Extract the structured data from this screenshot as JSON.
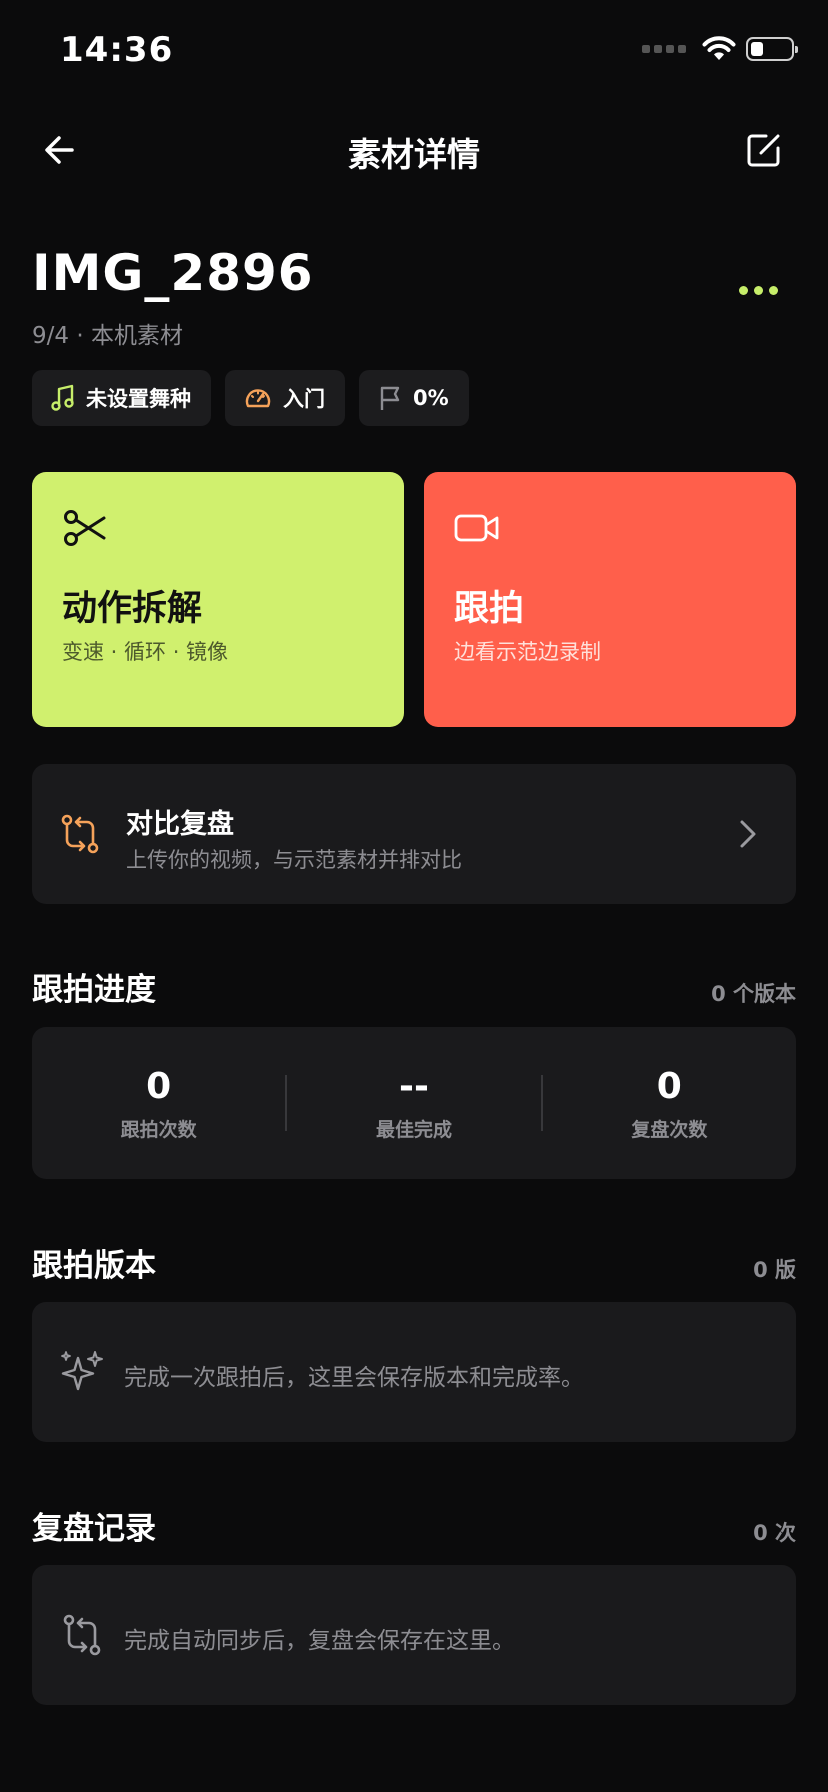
{
  "status_bar": {
    "time": "14:36"
  },
  "nav": {
    "title": "素材详情"
  },
  "asset": {
    "name": "IMG_2896",
    "date": "9/4",
    "separator": " · ",
    "source": "本机素材"
  },
  "chips": [
    {
      "label": "未设置舞种",
      "icon": "music-note-icon"
    },
    {
      "label": "入门",
      "icon": "speedometer-icon"
    },
    {
      "label": "0%",
      "icon": "flag-icon"
    }
  ],
  "actions": {
    "breakdown": {
      "title": "动作拆解",
      "subtitle": "变速 · 循环 · 镜像",
      "icon": "scissors-icon"
    },
    "follow": {
      "title": "跟拍",
      "subtitle": "边看示范边录制",
      "icon": "video-camera-icon"
    }
  },
  "compare": {
    "title": "对比复盘",
    "subtitle": "上传你的视频，与示范素材并排对比",
    "icon": "compare-arrows-icon"
  },
  "progress": {
    "title": "跟拍进度",
    "meta": "0 个版本",
    "stats": [
      {
        "value": "0",
        "label": "跟拍次数"
      },
      {
        "value": "--",
        "label": "最佳完成"
      },
      {
        "value": "0",
        "label": "复盘次数"
      }
    ]
  },
  "versions": {
    "title": "跟拍版本",
    "meta": "0 版",
    "empty_text": "完成一次跟拍后，这里会保存版本和完成率。",
    "icon": "sparkles-icon"
  },
  "reviews": {
    "title": "复盘记录",
    "meta": "0 次",
    "empty_text": "完成自动同步后，复盘会保存在这里。",
    "icon": "compare-arrows-icon"
  },
  "colors": {
    "background": "#0b0b0c",
    "card": "#1a1a1c",
    "accent_green": "#d0f06e",
    "accent_red": "#ff5f4b",
    "muted_text": "#8d8d92"
  }
}
